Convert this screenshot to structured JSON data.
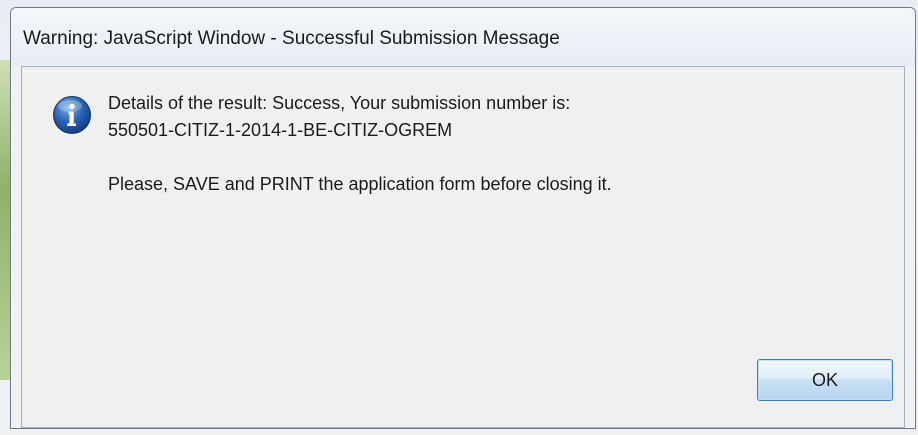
{
  "window": {
    "title": "Warning: JavaScript Window - Successful Submission Message"
  },
  "dialog": {
    "icon": "info-icon",
    "message_line1": "Details of the result: Success, Your submission number is:",
    "message_line2": "550501-CITIZ-1-2014-1-BE-CITIZ-OGREM",
    "message_line3": "Please, SAVE and PRINT the application form before closing it.",
    "ok_label": "OK"
  },
  "colors": {
    "icon_blue": "#2b63b5",
    "button_border": "#3c7fb1"
  }
}
